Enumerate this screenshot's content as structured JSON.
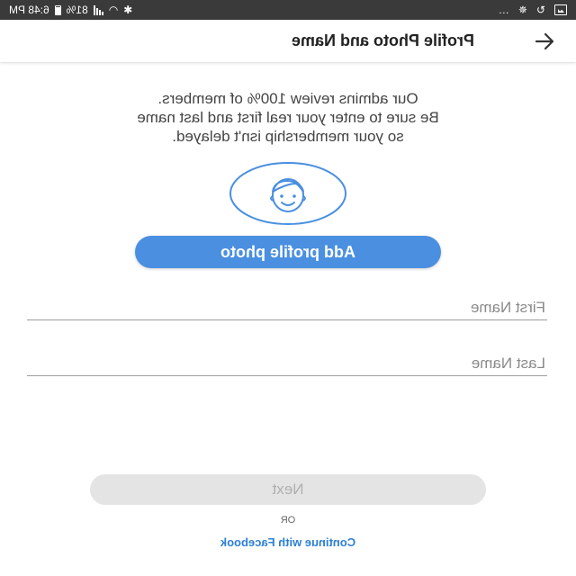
{
  "status_bar": {
    "time": "6:48 PM",
    "battery_percent": "81%",
    "overflow": "…"
  },
  "app_bar": {
    "title": "Profile Photo and Name",
    "back_icon": "arrow-left-icon"
  },
  "intro": {
    "lines": [
      "Our admins review 100% of members.",
      "Be sure to enter your real first and last name",
      "so your membership isn't delayed."
    ]
  },
  "avatar": {
    "icon": "face-icon",
    "color": "#4a8fe0"
  },
  "photo_button": {
    "label": "Add profile photo",
    "color": "#4a8fe0"
  },
  "form": {
    "first_name": {
      "value": "",
      "placeholder": "First Name"
    },
    "last_name": {
      "value": "",
      "placeholder": "Last Name"
    }
  },
  "next_button": {
    "label": "Next",
    "enabled": false
  },
  "or_label": "OR",
  "facebook_link": {
    "label": "Continue with Facebook",
    "color": "#2d7fd3"
  }
}
